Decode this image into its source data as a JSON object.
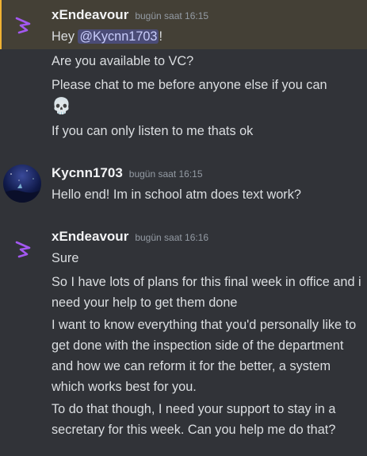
{
  "messages": [
    {
      "username": "xEndeavour",
      "timestamp": "bugün saat 16:15",
      "lines": {
        "l0_pre": "Hey ",
        "l0_mention": "@Kycnn1703",
        "l0_post": "!",
        "l1": "Are you available to VC?",
        "l2": "Please chat to me before anyone else if you can",
        "l3": "💀",
        "l4": "If you can only listen to me thats ok"
      }
    },
    {
      "username": "Kycnn1703",
      "timestamp": "bugün saat 16:15",
      "lines": {
        "l0": "Hello end! Im in school atm does text work?"
      }
    },
    {
      "username": "xEndeavour",
      "timestamp": "bugün saat 16:16",
      "lines": {
        "l0": "Sure",
        "l1": "So I have lots of plans for this final week in office and i need your help to get them done",
        "l2": "I want to know everything that you'd personally like to get done with the inspection side of the department and how we can reform it for the better, a system which works best for you.",
        "l3": "To do that though, I need your support to stay in a secretary for this week. Can you help me do that?"
      }
    }
  ],
  "colors": {
    "background": "#313338",
    "highlight": "#444036",
    "highlight_border": "#f0b232",
    "mention_bg": "#4a4f7a",
    "avatar_icon": "#a358f0"
  },
  "icons": {
    "xendeavour_avatar": "purple-feather-logo-icon",
    "kycnn_avatar": "night-sky-photo-avatar"
  }
}
